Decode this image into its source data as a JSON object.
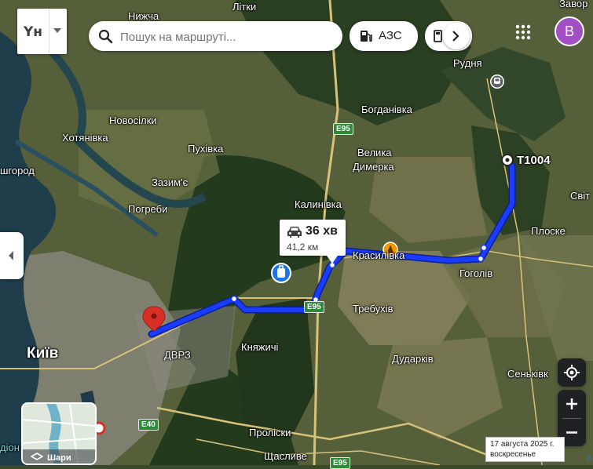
{
  "search": {
    "placeholder": "Пошук на маршруті..."
  },
  "logo": {
    "text": "Yн"
  },
  "chips": {
    "fuel_label": "АЗС"
  },
  "account": {
    "initial": "B",
    "color": "#a24fc4"
  },
  "route": {
    "duration": "36 хв",
    "distance": "41,2 км",
    "destination": "Т1004",
    "color": "#1a3cff"
  },
  "places": {
    "nyzhcha": "Нижча",
    "litky": "Літки",
    "zavor": "Завор",
    "rudnia": "Рудня",
    "bohdanivka": "Богданівка",
    "novosilky": "Новосілки",
    "khotianivka": "Хотянівка",
    "pukhivka": "Пухівка",
    "velyka_dymerka_1": "Велика",
    "velyka_dymerka_2": "Димерка",
    "shgorod": "шгород",
    "zazymie": "Зазим'є",
    "svit": "Світ",
    "pohreby": "Погреби",
    "kalynivka": "Калинівка",
    "ploske": "Плоске",
    "krasylivka": "Красилівка",
    "hoholiv": "Гоголів",
    "trebukhiv": "Требухів",
    "kyiv": "Київ",
    "dvrz": "ДВРЗ",
    "kniazhychi": "Княжичі",
    "dudarkiv": "Дударків",
    "senkivka": "Сеньківк",
    "proliski": "Проліски",
    "shchaslyve": "Щасливе",
    "dion": "діон"
  },
  "roads": {
    "e95_top": "E95",
    "e95_mid": "E95",
    "e40": "E40",
    "e95_bottom": "E95"
  },
  "date_tooltip": {
    "date": "17 августа 2025 г.",
    "weekday": "воскресенье"
  },
  "layers": {
    "label": "Шари"
  },
  "partial_right_text": "В"
}
